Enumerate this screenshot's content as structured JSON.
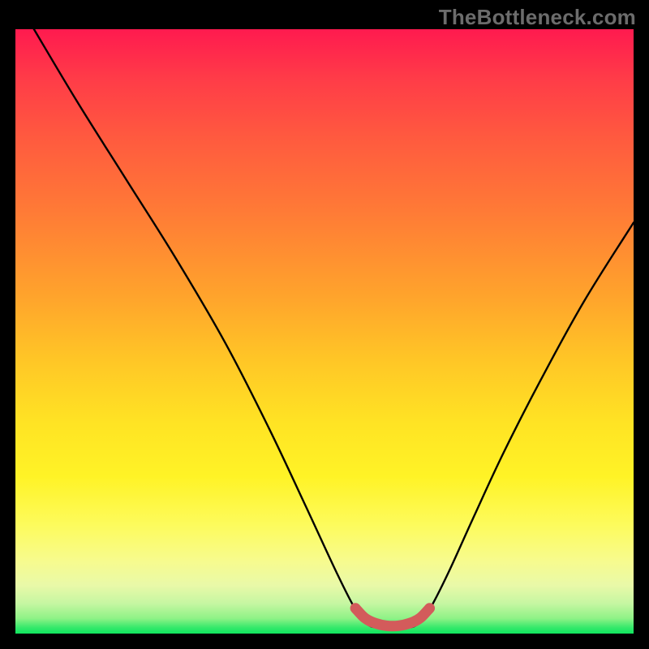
{
  "watermark": "TheBottleneck.com",
  "chart_data": {
    "type": "line",
    "title": "",
    "xlabel": "",
    "ylabel": "",
    "xlim": [
      0,
      100
    ],
    "ylim": [
      0,
      100
    ],
    "series": [
      {
        "name": "bottleneck-curve",
        "x": [
          3,
          10,
          18,
          26,
          34,
          41,
          47,
          52,
          55,
          57,
          59,
          63,
          65,
          67,
          70,
          74,
          79,
          85,
          92,
          100
        ],
        "y": [
          100,
          88,
          75,
          62,
          48,
          34,
          21,
          10,
          4,
          1.5,
          1,
          1,
          1.5,
          4,
          10,
          19,
          30,
          42,
          55,
          68
        ]
      },
      {
        "name": "optimal-zone",
        "x": [
          55,
          56.5,
          58,
          60,
          62,
          64,
          65.5,
          67
        ],
        "y": [
          4.2,
          2.6,
          1.8,
          1.3,
          1.3,
          1.8,
          2.6,
          4.2
        ]
      }
    ],
    "colors": {
      "curve": "#000000",
      "optimal_zone": "#d35b5b",
      "gradient_top": "#ff1a4f",
      "gradient_bottom": "#10e55e"
    }
  }
}
